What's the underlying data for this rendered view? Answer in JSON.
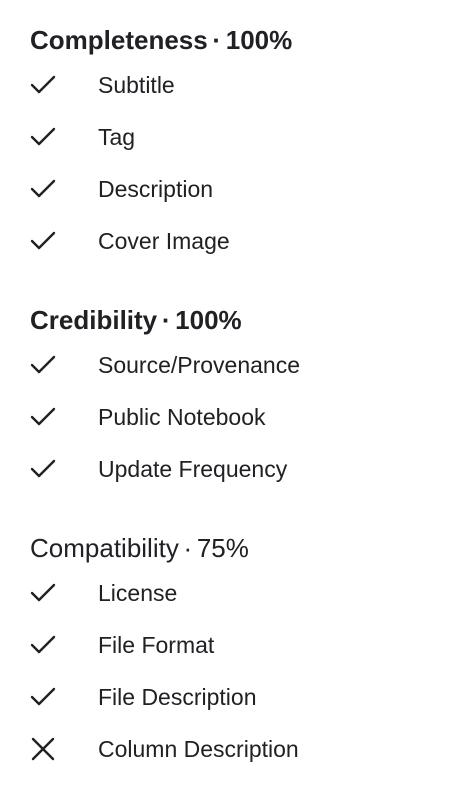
{
  "sections": [
    {
      "name": "Completeness",
      "score": "100%",
      "items": [
        {
          "label": "Subtitle",
          "status": "check-icon"
        },
        {
          "label": "Tag",
          "status": "check-icon"
        },
        {
          "label": "Description",
          "status": "check-icon"
        },
        {
          "label": "Cover Image",
          "status": "check-icon"
        }
      ]
    },
    {
      "name": "Credibility",
      "score": "100%",
      "items": [
        {
          "label": "Source/Provenance",
          "status": "check-icon"
        },
        {
          "label": "Public Notebook",
          "status": "check-icon"
        },
        {
          "label": "Update Frequency",
          "status": "check-icon"
        }
      ]
    },
    {
      "name": "Compatibility",
      "score": "75%",
      "items": [
        {
          "label": "License",
          "status": "check-icon"
        },
        {
          "label": "File Format",
          "status": "check-icon"
        },
        {
          "label": "File Description",
          "status": "check-icon"
        },
        {
          "label": "Column Description",
          "status": "cross-icon"
        }
      ]
    }
  ],
  "separator": "·",
  "colors": {
    "text": "#202124",
    "icon": "#202124"
  }
}
